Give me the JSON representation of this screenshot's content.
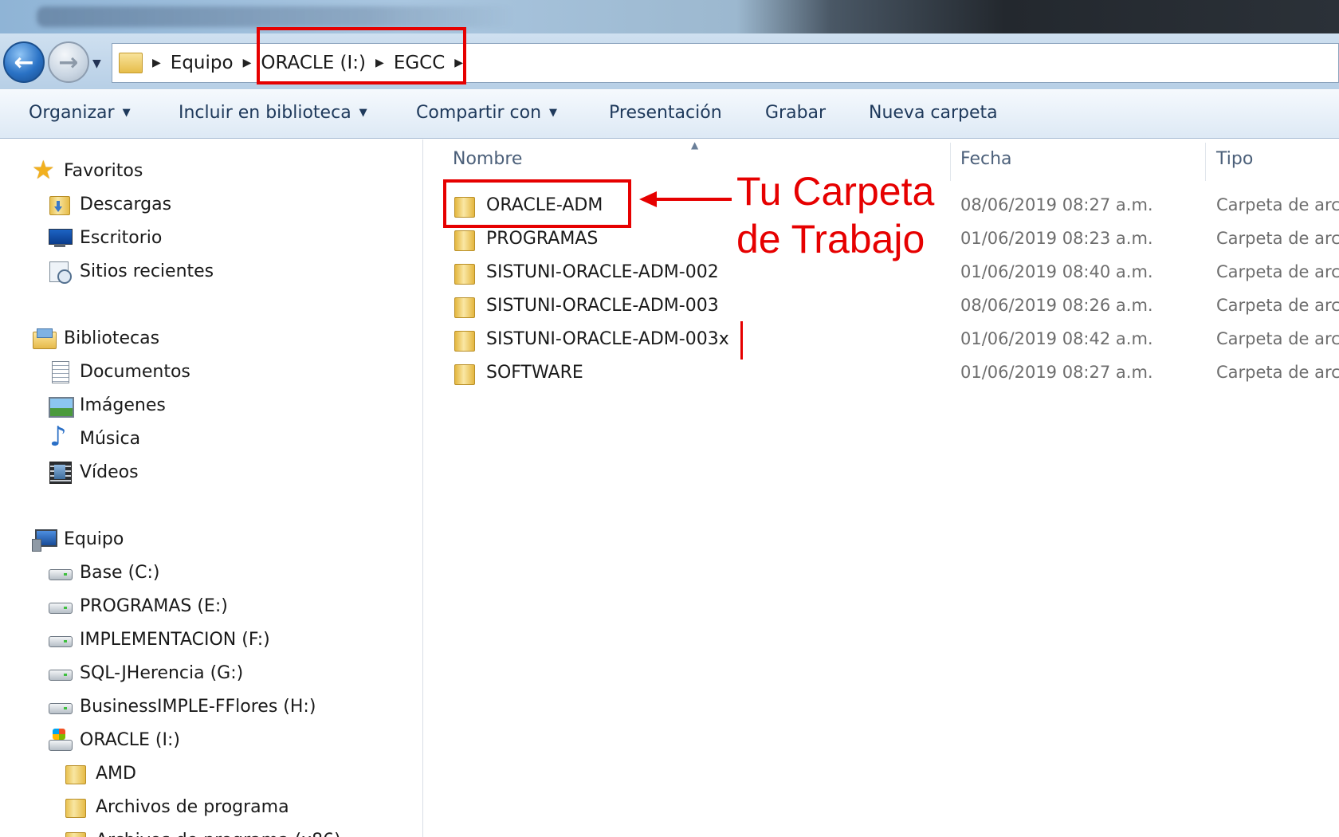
{
  "address_bar": {
    "crumbs": [
      "Equipo",
      "ORACLE (I:)",
      "EGCC"
    ]
  },
  "toolbar": {
    "organize": "Organizar",
    "include_library": "Incluir en biblioteca",
    "share_with": "Compartir con",
    "slideshow": "Presentación",
    "burn": "Grabar",
    "new_folder": "Nueva carpeta"
  },
  "nav": {
    "favorites": {
      "label": "Favoritos",
      "items": [
        "Descargas",
        "Escritorio",
        "Sitios recientes"
      ]
    },
    "libraries": {
      "label": "Bibliotecas",
      "items": [
        "Documentos",
        "Imágenes",
        "Música",
        "Vídeos"
      ]
    },
    "computer": {
      "label": "Equipo",
      "drives": [
        "Base (C:)",
        "PROGRAMAS (E:)",
        "IMPLEMENTACION (F:)",
        "SQL-JHerencia (G:)",
        "BusinessIMPLE-FFlores (H:)",
        "ORACLE (I:)"
      ],
      "subfolders": [
        "AMD",
        "Archivos de programa",
        "Archivos de programa (x86)"
      ]
    }
  },
  "columns": {
    "name": "Nombre",
    "date": "Fecha",
    "type": "Tipo"
  },
  "files": [
    {
      "name": "ORACLE-ADM",
      "date": "08/06/2019 08:27 a.m.",
      "type": "Carpeta de arc"
    },
    {
      "name": "PROGRAMAS",
      "date": "01/06/2019 08:23 a.m.",
      "type": "Carpeta de arc"
    },
    {
      "name": "SISTUNI-ORACLE-ADM-002",
      "date": "01/06/2019 08:40 a.m.",
      "type": "Carpeta de arc"
    },
    {
      "name": "SISTUNI-ORACLE-ADM-003",
      "date": "08/06/2019 08:26 a.m.",
      "type": "Carpeta de arc"
    },
    {
      "name": "SISTUNI-ORACLE-ADM-003x",
      "date": "01/06/2019 08:42 a.m.",
      "type": "Carpeta de arc"
    },
    {
      "name": "SOFTWARE",
      "date": "01/06/2019 08:27 a.m.",
      "type": "Carpeta de arc"
    }
  ],
  "annotation": {
    "line1": "Tu Carpeta",
    "line2": "de Trabajo",
    "color": "#e60000"
  }
}
